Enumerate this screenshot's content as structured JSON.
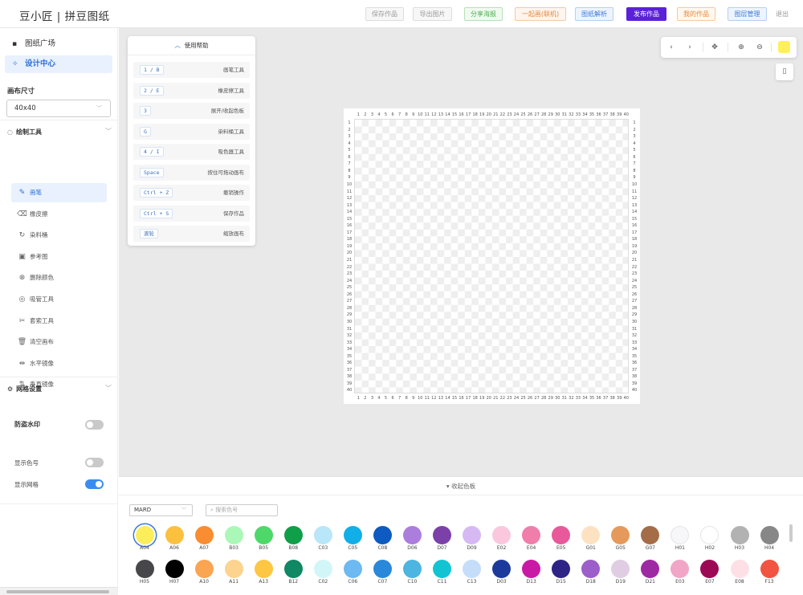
{
  "app_title": "豆小匠 | 拼豆图纸",
  "header_buttons": [
    {
      "label": "保存作品",
      "color": "#999",
      "border": "#ddd",
      "bg": "#f7f7f7"
    },
    {
      "label": "导出图片",
      "color": "#999",
      "border": "#ddd",
      "bg": "#f7f7f7"
    },
    {
      "label": "分享海报",
      "color": "#4caf50",
      "border": "#b7e1b9",
      "bg": "#f0faf0"
    },
    {
      "label": "一起画(联机)",
      "color": "#e8883a",
      "border": "#f3c9a3",
      "bg": "#fdf5ee"
    },
    {
      "label": "图纸解析",
      "color": "#3d7bd9",
      "border": "#b6cff2",
      "bg": "#eef4fd"
    },
    {
      "label": "发布作品",
      "color": "#fff",
      "border": "#5b21d9",
      "bg": "#5b21d9"
    },
    {
      "label": "我的作品",
      "color": "#e8883a",
      "border": "#f3c9a3",
      "bg": "#fff8ef"
    },
    {
      "label": "图层管理",
      "color": "#3d7bd9",
      "border": "#b6cff2",
      "bg": "#eef4fd"
    }
  ],
  "exit_label": "退出",
  "sidebar": {
    "nav": [
      {
        "label": "图纸广场",
        "icon": "gallery-icon",
        "active": false
      },
      {
        "label": "设计中心",
        "icon": "magic-wand-icon",
        "active": true
      }
    ],
    "canvas_size_label": "画布尺寸",
    "canvas_size_value": "40x40",
    "draw_tools_label": "绘制工具",
    "tools": [
      {
        "label": "画笔",
        "icon": "brush-icon",
        "glyph": "✎",
        "active": true
      },
      {
        "label": "橡皮擦",
        "icon": "eraser-icon",
        "glyph": "⌫",
        "active": false
      },
      {
        "label": "染料桶",
        "icon": "bucket-icon",
        "glyph": "↻",
        "active": false
      },
      {
        "label": "参考图",
        "icon": "image-icon",
        "glyph": "▣",
        "active": false
      },
      {
        "label": "删除颜色",
        "icon": "delete-color-icon",
        "glyph": "⊗",
        "active": false
      },
      {
        "label": "吸管工具",
        "icon": "eyedropper-icon",
        "glyph": "◎",
        "active": false
      },
      {
        "label": "套索工具",
        "icon": "lasso-icon",
        "glyph": "✂",
        "active": false
      },
      {
        "label": "清空画布",
        "icon": "trash-icon",
        "glyph": "🗑",
        "active": false
      },
      {
        "label": "水平镜像",
        "icon": "flip-horizontal-icon",
        "glyph": "⇹",
        "active": false
      },
      {
        "label": "垂直镜像",
        "icon": "flip-vertical-icon",
        "glyph": "⇅",
        "active": false
      }
    ],
    "grid_settings_label": "网格设置",
    "watermark_label": "防盗水印",
    "watermark_on": false,
    "show_color_code_label": "显示色号",
    "show_color_code_on": false,
    "show_grid_label": "显示网格",
    "show_grid_on": true
  },
  "help": {
    "title": "使用帮助",
    "rows": [
      {
        "key": "1 / B",
        "desc": "画笔工具"
      },
      {
        "key": "2 / E",
        "desc": "橡皮擦工具"
      },
      {
        "key": "3",
        "desc": "展开/收起色板"
      },
      {
        "key": "G",
        "desc": "染料桶工具"
      },
      {
        "key": "4 / I",
        "desc": "吸色器工具"
      },
      {
        "key": "Space",
        "desc": "按住可拖动画布"
      },
      {
        "key": "Ctrl + Z",
        "desc": "撤销操作"
      },
      {
        "key": "Ctrl + S",
        "desc": "保存作品"
      },
      {
        "key": "滚轮",
        "desc": "缩放画布"
      }
    ]
  },
  "toolbar": {
    "undo_icon": "chevron-left-icon",
    "redo_icon": "chevron-right-icon",
    "move_icon": "move-icon",
    "zoom_in_icon": "zoom-in-icon",
    "zoom_out_icon": "zoom-out-icon",
    "current_color": "#ffef5b"
  },
  "grid_size": 40,
  "palette_toggle_label": "▾ 收起色板",
  "palette_brand": "MARD",
  "palette_search_placeholder": "搜索色号",
  "palette": [
    {
      "code": "A04",
      "hex": "#fcee5a",
      "selected": true
    },
    {
      "code": "A06",
      "hex": "#fbc03e"
    },
    {
      "code": "A07",
      "hex": "#fa8c32"
    },
    {
      "code": "B03",
      "hex": "#abf7b7"
    },
    {
      "code": "B05",
      "hex": "#4fd86a"
    },
    {
      "code": "B08",
      "hex": "#0e9f48"
    },
    {
      "code": "C03",
      "hex": "#b9e6f8"
    },
    {
      "code": "C05",
      "hex": "#12aee8"
    },
    {
      "code": "C08",
      "hex": "#0d5ac0"
    },
    {
      "code": "D06",
      "hex": "#ab7ddc"
    },
    {
      "code": "D07",
      "hex": "#7c41a8"
    },
    {
      "code": "D09",
      "hex": "#d6b9f3"
    },
    {
      "code": "E02",
      "hex": "#fac7dd"
    },
    {
      "code": "E04",
      "hex": "#ef7eab"
    },
    {
      "code": "E05",
      "hex": "#e8599b"
    },
    {
      "code": "G01",
      "hex": "#fde2c2"
    },
    {
      "code": "G05",
      "hex": "#e59a5b"
    },
    {
      "code": "G07",
      "hex": "#a46d48"
    },
    {
      "code": "H01",
      "hex": "#f7f7f9"
    },
    {
      "code": "H02",
      "hex": "#ffffff"
    },
    {
      "code": "H03",
      "hex": "#b2b2b2"
    },
    {
      "code": "H04",
      "hex": "#878787"
    },
    {
      "code": "H05",
      "hex": "#46464b"
    },
    {
      "code": "H07",
      "hex": "#000000"
    },
    {
      "code": "A10",
      "hex": "#f9a552"
    },
    {
      "code": "A11",
      "hex": "#fcd38f"
    },
    {
      "code": "A13",
      "hex": "#fdc744"
    },
    {
      "code": "B12",
      "hex": "#0f8863"
    },
    {
      "code": "C02",
      "hex": "#d2f6f8"
    },
    {
      "code": "C06",
      "hex": "#6db9f1"
    },
    {
      "code": "C07",
      "hex": "#2a88da"
    },
    {
      "code": "C10",
      "hex": "#4cb5e0"
    },
    {
      "code": "C11",
      "hex": "#12c4d2"
    },
    {
      "code": "C13",
      "hex": "#c5ddf8"
    },
    {
      "code": "D03",
      "hex": "#1b3a9c"
    },
    {
      "code": "D13",
      "hex": "#c91aa5"
    },
    {
      "code": "D15",
      "hex": "#2d2485"
    },
    {
      "code": "D18",
      "hex": "#9c5ec8"
    },
    {
      "code": "D19",
      "hex": "#e0cde3"
    },
    {
      "code": "D21",
      "hex": "#9e2aa3"
    },
    {
      "code": "E03",
      "hex": "#f1a6c7"
    },
    {
      "code": "E07",
      "hex": "#9c0854"
    },
    {
      "code": "E08",
      "hex": "#fde0e6"
    },
    {
      "code": "F13",
      "hex": "#f15441"
    }
  ]
}
